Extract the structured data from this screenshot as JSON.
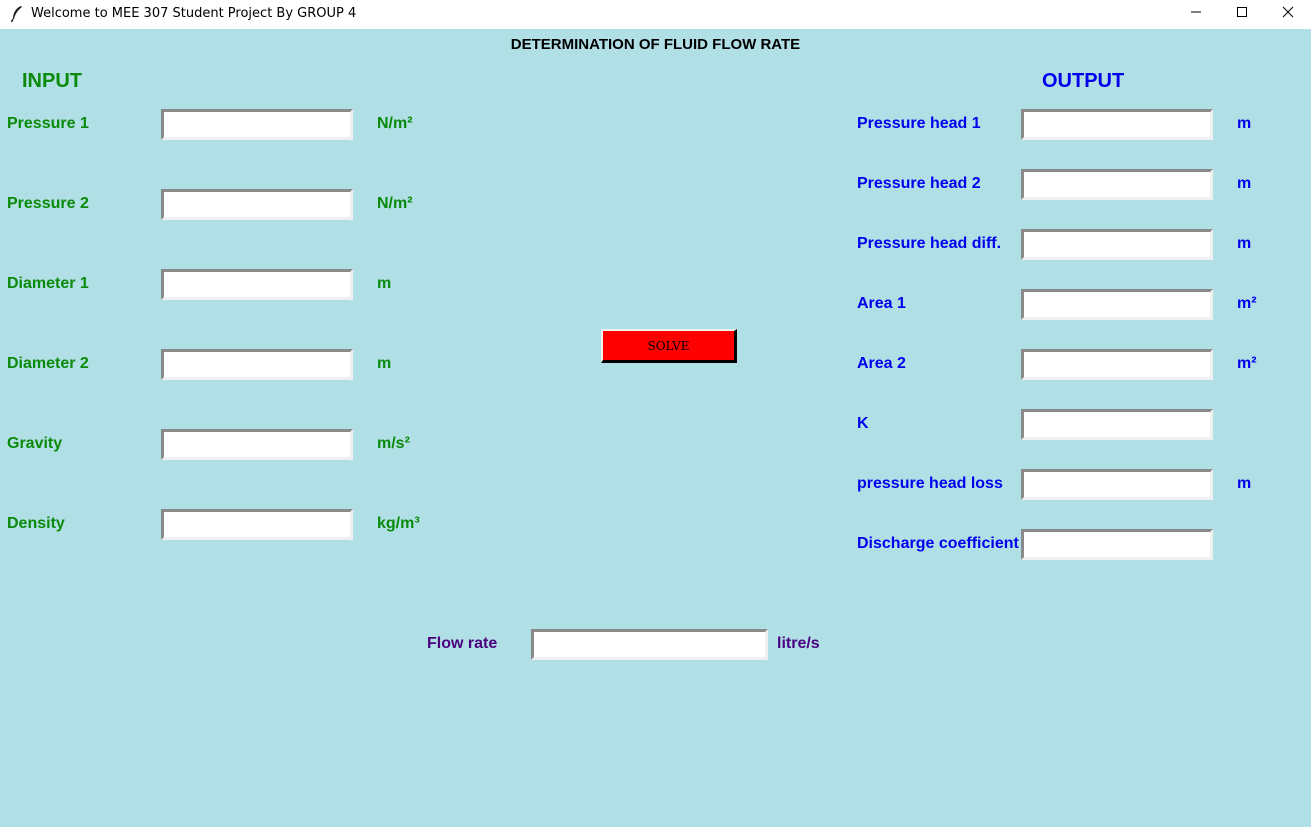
{
  "window": {
    "title": "Welcome to MEE 307 Student Project By GROUP 4",
    "icon": "feather-icon",
    "controls": [
      "minimize-icon",
      "maximize-icon",
      "close-icon"
    ]
  },
  "heading": "DETERMINATION OF FLUID FLOW RATE",
  "input": {
    "title": "INPUT",
    "fields": [
      {
        "label": "Pressure 1",
        "value": "",
        "unit": "N/m²"
      },
      {
        "label": "Pressure 2",
        "value": "",
        "unit": "N/m²"
      },
      {
        "label": "Diameter 1",
        "value": "",
        "unit": "m"
      },
      {
        "label": "Diameter 2",
        "value": "",
        "unit": "m"
      },
      {
        "label": "Gravity",
        "value": "",
        "unit": "m/s²"
      },
      {
        "label": "Density",
        "value": "",
        "unit": "kg/m³"
      }
    ]
  },
  "solve_button": {
    "label": "SOLVE"
  },
  "output": {
    "title": "OUTPUT",
    "fields": [
      {
        "label": "Pressure head 1",
        "value": "",
        "unit": "m"
      },
      {
        "label": "Pressure head 2",
        "value": "",
        "unit": "m"
      },
      {
        "label": "Pressure head diff.",
        "value": "",
        "unit": "m"
      },
      {
        "label": "Area 1",
        "value": "",
        "unit": "m²"
      },
      {
        "label": "Area 2",
        "value": "",
        "unit": "m²"
      },
      {
        "label": "K",
        "value": "",
        "unit": ""
      },
      {
        "label": "pressure head loss",
        "value": "",
        "unit": "m"
      },
      {
        "label": "Discharge coefficient",
        "value": "",
        "unit": ""
      }
    ]
  },
  "flow_rate": {
    "label": "Flow rate",
    "value": "",
    "unit": "litre/s"
  },
  "colors": {
    "background": "#b0dfe5",
    "input_text": "#0a8a0a",
    "output_text": "#0000ee",
    "flow_text": "#4b0082",
    "solve_button": "#ff0000"
  }
}
